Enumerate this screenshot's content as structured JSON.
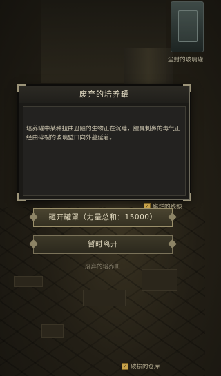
{
  "scene": {
    "top_location_label": "尘封的玻璃罐",
    "bottom_location_label": "破损的仓库",
    "mid_location_label": "废弃的培养皿"
  },
  "dialog": {
    "title": "废弃的培养罐",
    "description": "培养罐中某种扭曲丑陋的生物正在沉睡，腥臭刺鼻的毒气正经由碎裂的玻璃壁口向外蔓延着。"
  },
  "flags": {
    "checked_label": "腐烂的残骸"
  },
  "actions": {
    "primary_label": "砸开罐罩（力量总和：15000）",
    "secondary_label": "暂时离开"
  },
  "colors": {
    "accent": "#c7a24a",
    "text": "#e4dcc2"
  }
}
